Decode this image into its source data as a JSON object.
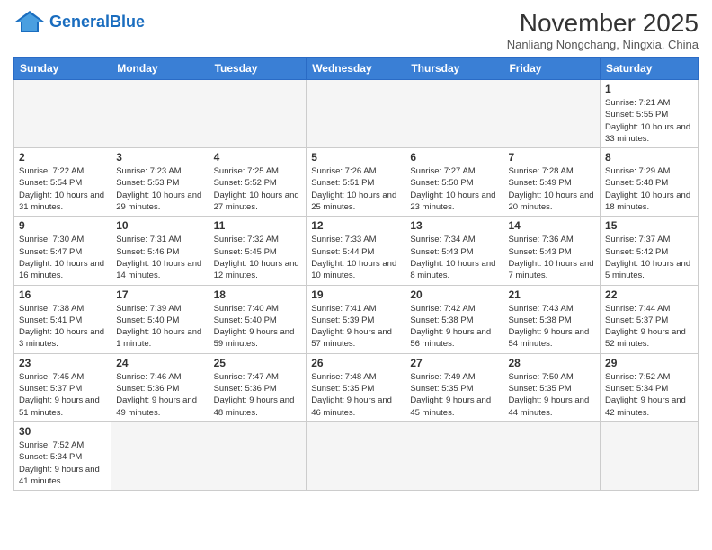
{
  "header": {
    "logo_general": "General",
    "logo_blue": "Blue",
    "month_title": "November 2025",
    "location": "Nanliang Nongchang, Ningxia, China"
  },
  "weekdays": [
    "Sunday",
    "Monday",
    "Tuesday",
    "Wednesday",
    "Thursday",
    "Friday",
    "Saturday"
  ],
  "weeks": [
    [
      {
        "day": "",
        "empty": true
      },
      {
        "day": "",
        "empty": true
      },
      {
        "day": "",
        "empty": true
      },
      {
        "day": "",
        "empty": true
      },
      {
        "day": "",
        "empty": true
      },
      {
        "day": "",
        "empty": true
      },
      {
        "day": "1",
        "info": "Sunrise: 7:21 AM\nSunset: 5:55 PM\nDaylight: 10 hours\nand 33 minutes."
      }
    ],
    [
      {
        "day": "2",
        "info": "Sunrise: 7:22 AM\nSunset: 5:54 PM\nDaylight: 10 hours\nand 31 minutes."
      },
      {
        "day": "3",
        "info": "Sunrise: 7:23 AM\nSunset: 5:53 PM\nDaylight: 10 hours\nand 29 minutes."
      },
      {
        "day": "4",
        "info": "Sunrise: 7:25 AM\nSunset: 5:52 PM\nDaylight: 10 hours\nand 27 minutes."
      },
      {
        "day": "5",
        "info": "Sunrise: 7:26 AM\nSunset: 5:51 PM\nDaylight: 10 hours\nand 25 minutes."
      },
      {
        "day": "6",
        "info": "Sunrise: 7:27 AM\nSunset: 5:50 PM\nDaylight: 10 hours\nand 23 minutes."
      },
      {
        "day": "7",
        "info": "Sunrise: 7:28 AM\nSunset: 5:49 PM\nDaylight: 10 hours\nand 20 minutes."
      },
      {
        "day": "8",
        "info": "Sunrise: 7:29 AM\nSunset: 5:48 PM\nDaylight: 10 hours\nand 18 minutes."
      }
    ],
    [
      {
        "day": "9",
        "info": "Sunrise: 7:30 AM\nSunset: 5:47 PM\nDaylight: 10 hours\nand 16 minutes."
      },
      {
        "day": "10",
        "info": "Sunrise: 7:31 AM\nSunset: 5:46 PM\nDaylight: 10 hours\nand 14 minutes."
      },
      {
        "day": "11",
        "info": "Sunrise: 7:32 AM\nSunset: 5:45 PM\nDaylight: 10 hours\nand 12 minutes."
      },
      {
        "day": "12",
        "info": "Sunrise: 7:33 AM\nSunset: 5:44 PM\nDaylight: 10 hours\nand 10 minutes."
      },
      {
        "day": "13",
        "info": "Sunrise: 7:34 AM\nSunset: 5:43 PM\nDaylight: 10 hours\nand 8 minutes."
      },
      {
        "day": "14",
        "info": "Sunrise: 7:36 AM\nSunset: 5:43 PM\nDaylight: 10 hours\nand 7 minutes."
      },
      {
        "day": "15",
        "info": "Sunrise: 7:37 AM\nSunset: 5:42 PM\nDaylight: 10 hours\nand 5 minutes."
      }
    ],
    [
      {
        "day": "16",
        "info": "Sunrise: 7:38 AM\nSunset: 5:41 PM\nDaylight: 10 hours\nand 3 minutes."
      },
      {
        "day": "17",
        "info": "Sunrise: 7:39 AM\nSunset: 5:40 PM\nDaylight: 10 hours\nand 1 minute."
      },
      {
        "day": "18",
        "info": "Sunrise: 7:40 AM\nSunset: 5:40 PM\nDaylight: 9 hours\nand 59 minutes."
      },
      {
        "day": "19",
        "info": "Sunrise: 7:41 AM\nSunset: 5:39 PM\nDaylight: 9 hours\nand 57 minutes."
      },
      {
        "day": "20",
        "info": "Sunrise: 7:42 AM\nSunset: 5:38 PM\nDaylight: 9 hours\nand 56 minutes."
      },
      {
        "day": "21",
        "info": "Sunrise: 7:43 AM\nSunset: 5:38 PM\nDaylight: 9 hours\nand 54 minutes."
      },
      {
        "day": "22",
        "info": "Sunrise: 7:44 AM\nSunset: 5:37 PM\nDaylight: 9 hours\nand 52 minutes."
      }
    ],
    [
      {
        "day": "23",
        "info": "Sunrise: 7:45 AM\nSunset: 5:37 PM\nDaylight: 9 hours\nand 51 minutes."
      },
      {
        "day": "24",
        "info": "Sunrise: 7:46 AM\nSunset: 5:36 PM\nDaylight: 9 hours\nand 49 minutes."
      },
      {
        "day": "25",
        "info": "Sunrise: 7:47 AM\nSunset: 5:36 PM\nDaylight: 9 hours\nand 48 minutes."
      },
      {
        "day": "26",
        "info": "Sunrise: 7:48 AM\nSunset: 5:35 PM\nDaylight: 9 hours\nand 46 minutes."
      },
      {
        "day": "27",
        "info": "Sunrise: 7:49 AM\nSunset: 5:35 PM\nDaylight: 9 hours\nand 45 minutes."
      },
      {
        "day": "28",
        "info": "Sunrise: 7:50 AM\nSunset: 5:35 PM\nDaylight: 9 hours\nand 44 minutes."
      },
      {
        "day": "29",
        "info": "Sunrise: 7:52 AM\nSunset: 5:34 PM\nDaylight: 9 hours\nand 42 minutes."
      }
    ],
    [
      {
        "day": "30",
        "info": "Sunrise: 7:52 AM\nSunset: 5:34 PM\nDaylight: 9 hours\nand 41 minutes."
      },
      {
        "day": "",
        "empty": true
      },
      {
        "day": "",
        "empty": true
      },
      {
        "day": "",
        "empty": true
      },
      {
        "day": "",
        "empty": true
      },
      {
        "day": "",
        "empty": true
      },
      {
        "day": "",
        "empty": true
      }
    ]
  ]
}
